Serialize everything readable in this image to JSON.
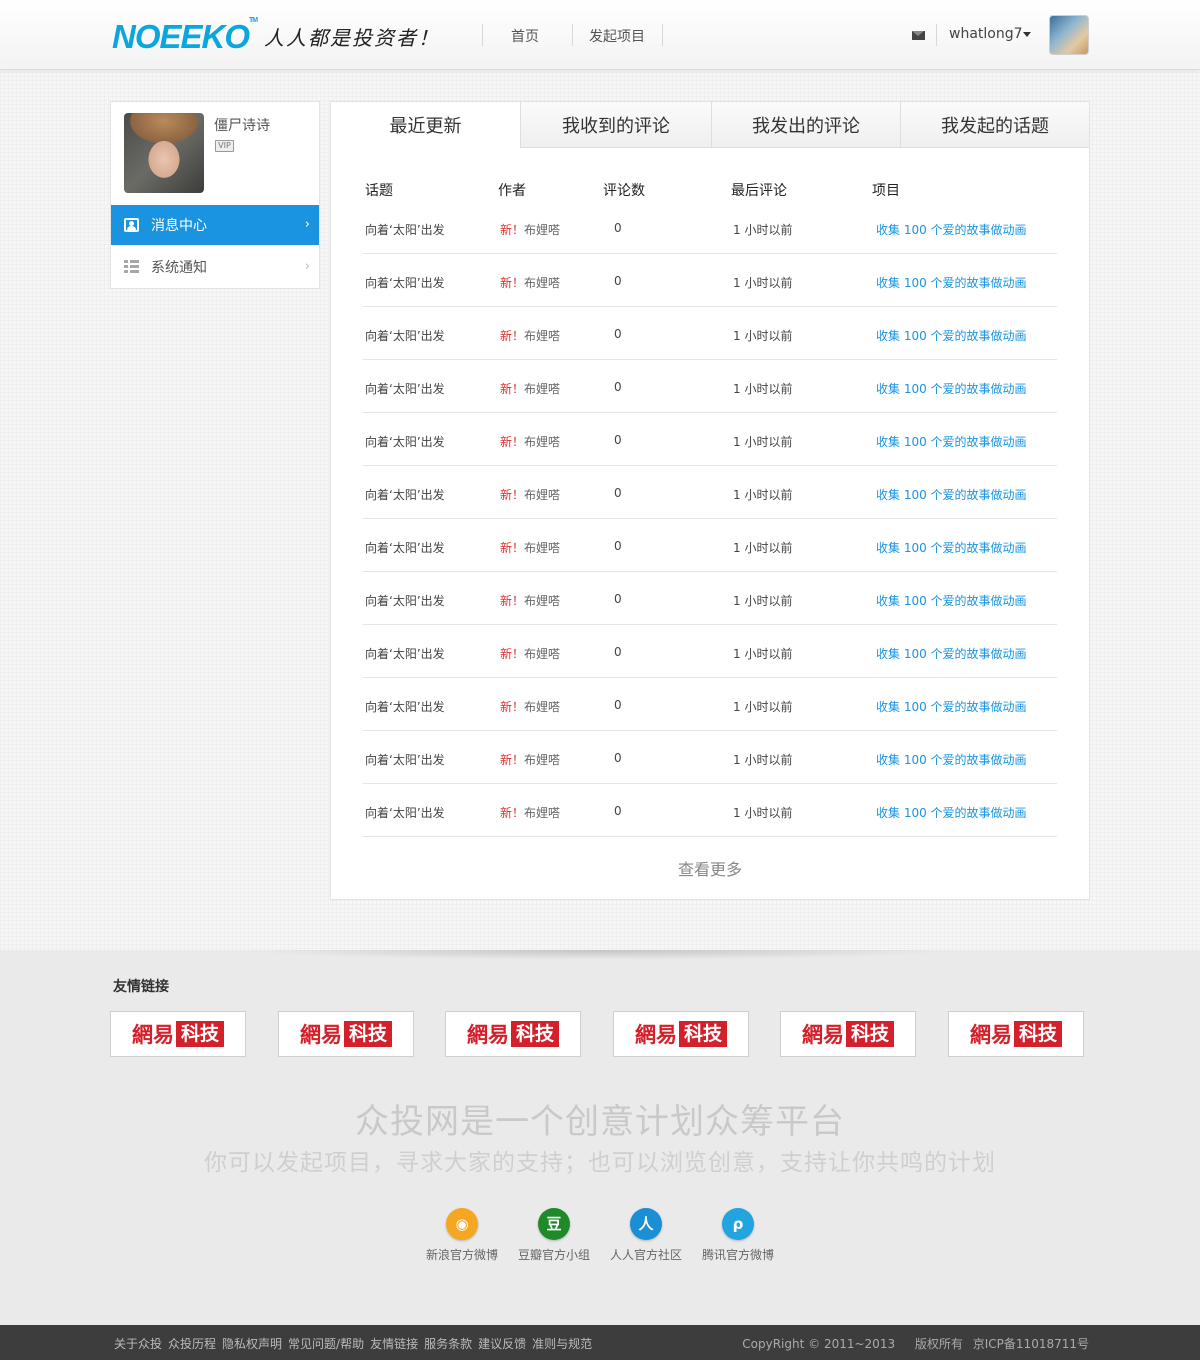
{
  "header": {
    "logo": "NOEEKO",
    "logo_tm": "TM",
    "slogan": "人人都是投资者！",
    "nav": [
      "首页",
      "发起项目"
    ],
    "username": "whatlong7"
  },
  "sidebar": {
    "profile_name": "僵尸诗诗",
    "badge": "VIP",
    "items": [
      {
        "label": "消息中心",
        "chevron": "›"
      },
      {
        "label": "系统通知",
        "chevron": "›"
      }
    ]
  },
  "tabs": [
    "最近更新",
    "我收到的评论",
    "我发出的评论",
    "我发起的话题"
  ],
  "table": {
    "headers": [
      "话题",
      "作者",
      "评论数",
      "最后评论",
      "项目"
    ],
    "rows": [
      {
        "topic": "向着‘太阳’出发",
        "new": "新！",
        "author": "布娌嗒",
        "count": "0",
        "last": "1 小时以前",
        "project": "收集 100 个爱的故事做动画"
      },
      {
        "topic": "向着‘太阳’出发",
        "new": "新！",
        "author": "布娌嗒",
        "count": "0",
        "last": "1 小时以前",
        "project": "收集 100 个爱的故事做动画"
      },
      {
        "topic": "向着‘太阳’出发",
        "new": "新！",
        "author": "布娌嗒",
        "count": "0",
        "last": "1 小时以前",
        "project": "收集 100 个爱的故事做动画"
      },
      {
        "topic": "向着‘太阳’出发",
        "new": "新！",
        "author": "布娌嗒",
        "count": "0",
        "last": "1 小时以前",
        "project": "收集 100 个爱的故事做动画"
      },
      {
        "topic": "向着‘太阳’出发",
        "new": "新！",
        "author": "布娌嗒",
        "count": "0",
        "last": "1 小时以前",
        "project": "收集 100 个爱的故事做动画"
      },
      {
        "topic": "向着‘太阳’出发",
        "new": "新！",
        "author": "布娌嗒",
        "count": "0",
        "last": "1 小时以前",
        "project": "收集 100 个爱的故事做动画"
      },
      {
        "topic": "向着‘太阳’出发",
        "new": "新！",
        "author": "布娌嗒",
        "count": "0",
        "last": "1 小时以前",
        "project": "收集 100 个爱的故事做动画"
      },
      {
        "topic": "向着‘太阳’出发",
        "new": "新！",
        "author": "布娌嗒",
        "count": "0",
        "last": "1 小时以前",
        "project": "收集 100 个爱的故事做动画"
      },
      {
        "topic": "向着‘太阳’出发",
        "new": "新！",
        "author": "布娌嗒",
        "count": "0",
        "last": "1 小时以前",
        "project": "收集 100 个爱的故事做动画"
      },
      {
        "topic": "向着‘太阳’出发",
        "new": "新！",
        "author": "布娌嗒",
        "count": "0",
        "last": "1 小时以前",
        "project": "收集 100 个爱的故事做动画"
      },
      {
        "topic": "向着‘太阳’出发",
        "new": "新！",
        "author": "布娌嗒",
        "count": "0",
        "last": "1 小时以前",
        "project": "收集 100 个爱的故事做动画"
      },
      {
        "topic": "向着‘太阳’出发",
        "new": "新！",
        "author": "布娌嗒",
        "count": "0",
        "last": "1 小时以前",
        "project": "收集 100 个爱的故事做动画"
      }
    ],
    "more": "查看更多"
  },
  "footer": {
    "friend_title": "友情链接",
    "partner_logo_a": "網易",
    "partner_logo_b": "科技",
    "tagline1": "众投网是一个创意计划众筹平台",
    "tagline2": "你可以发起项目，寻求大家的支持；也可以浏览创意，支持让你共鸣的计划",
    "social": [
      {
        "label": "新浪官方微博",
        "glyph": "◉",
        "color": "#f5a623"
      },
      {
        "label": "豆瓣官方小组",
        "glyph": "豆",
        "color": "#1e8a2a"
      },
      {
        "label": "人人官方社区",
        "glyph": "人",
        "color": "#1a8fd6"
      },
      {
        "label": "腾讯官方微博",
        "glyph": "ρ",
        "color": "#22a4e0"
      }
    ],
    "links": [
      "关于众投",
      "众投历程",
      "隐私权声明",
      "常见问题/帮助",
      "友情链接",
      "服务条款",
      "建议反馈",
      "准则与规范"
    ],
    "copyright": "CopyRight © 2011~2013",
    "rights": "版权所有",
    "icp": "京ICP备11018711号"
  },
  "colors": {
    "accent": "#1a94e0",
    "logo": "#0ca6de",
    "new_tag": "#e03030",
    "partner_red": "#d3202a"
  }
}
